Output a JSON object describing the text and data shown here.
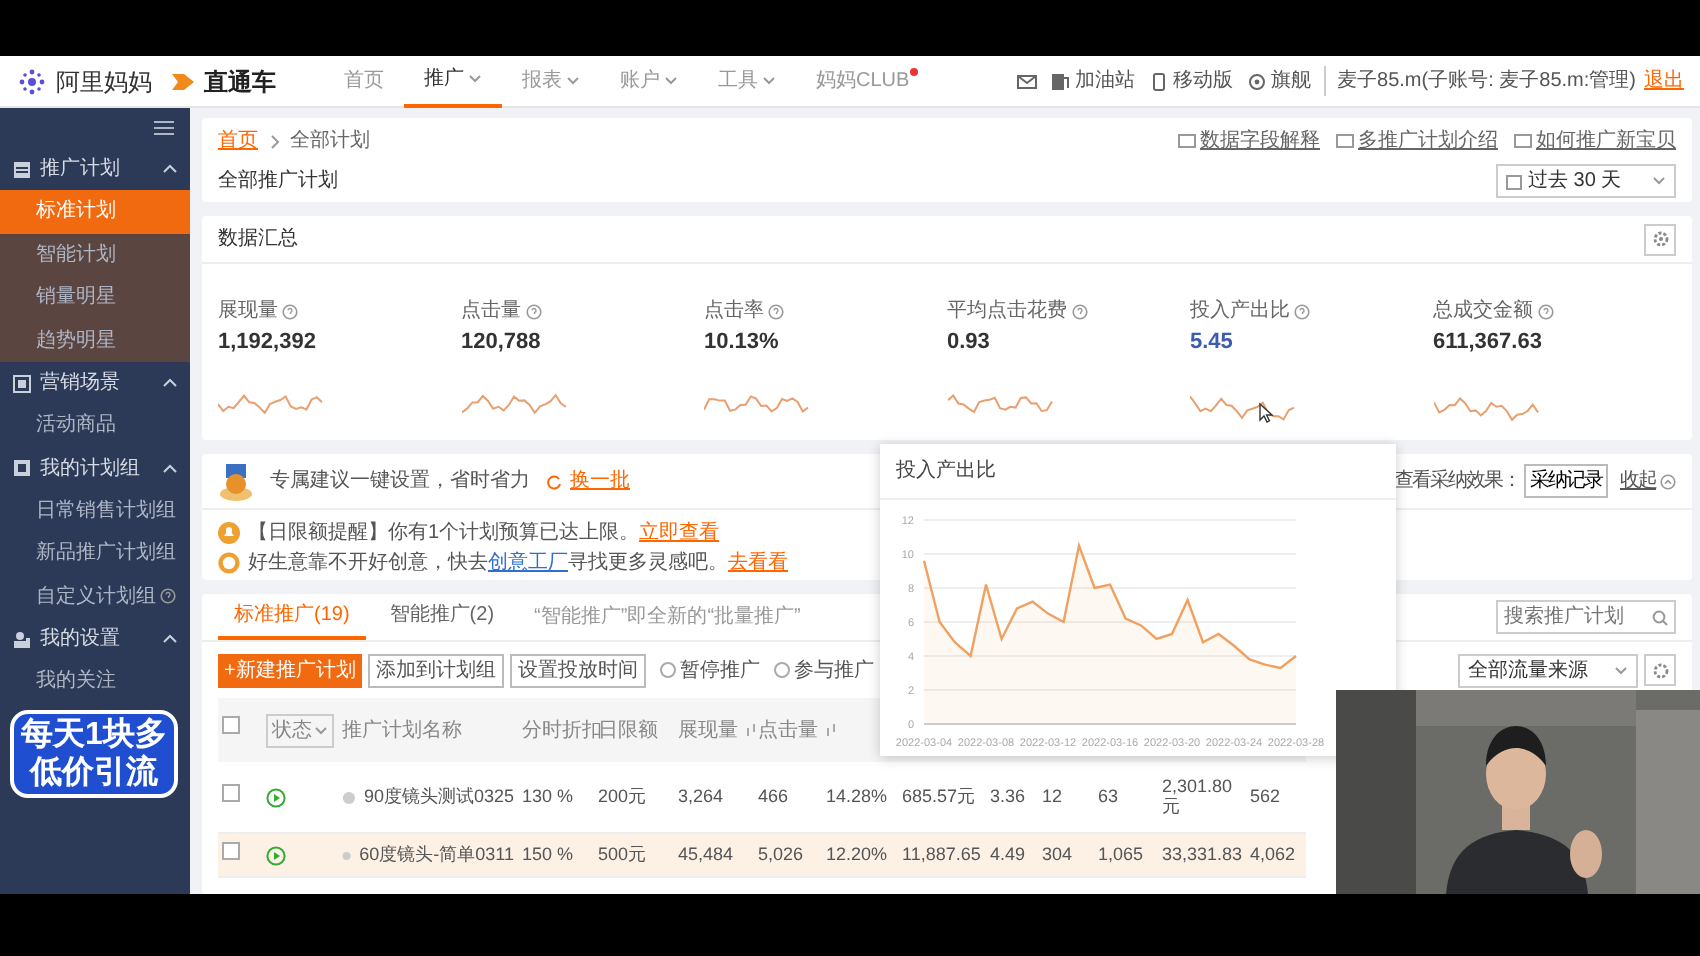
{
  "header": {
    "brand": "阿里妈妈",
    "product": "直通车",
    "nav": [
      {
        "label": "首页",
        "selected": false,
        "caret": false,
        "dot": false
      },
      {
        "label": "推广",
        "selected": true,
        "caret": true,
        "dot": false
      },
      {
        "label": "报表",
        "selected": false,
        "caret": true,
        "dot": false
      },
      {
        "label": "账户",
        "selected": false,
        "caret": true,
        "dot": false
      },
      {
        "label": "工具",
        "selected": false,
        "caret": true,
        "dot": false
      },
      {
        "label": "妈妈CLUB",
        "selected": false,
        "caret": false,
        "dot": true
      }
    ],
    "tools": [
      {
        "kind": "mail"
      },
      {
        "kind": "fuel",
        "label": "加油站"
      },
      {
        "kind": "phone",
        "label": "移动版"
      },
      {
        "kind": "flag",
        "label": "旗舰"
      }
    ],
    "account": "麦子85.m(子账号: 麦子85.m:管理)",
    "logout": "退出"
  },
  "sidebar": {
    "groups": [
      {
        "label": "推广计划",
        "expanded": true,
        "items": [
          {
            "label": "标准计划",
            "selected": true
          },
          {
            "label": "智能计划",
            "selected": false
          },
          {
            "label": "销量明星",
            "selected": false
          },
          {
            "label": "趋势明星",
            "selected": false
          }
        ]
      },
      {
        "label": "营销场景",
        "expanded": true,
        "items": [
          {
            "label": "活动商品",
            "selected": false
          }
        ]
      },
      {
        "label": "我的计划组",
        "expanded": true,
        "items": [
          {
            "label": "日常销售计划组",
            "selected": false
          },
          {
            "label": "新品推广计划组",
            "selected": false
          },
          {
            "label": "自定义计划组",
            "selected": false,
            "help": true
          }
        ]
      },
      {
        "label": "我的设置",
        "expanded": true,
        "items": [
          {
            "label": "我的关注",
            "selected": false
          }
        ]
      }
    ]
  },
  "page": {
    "breadcrumb": [
      "首页",
      "全部计划"
    ],
    "title": "全部推广计划",
    "links": [
      "数据字段解释",
      "多推广计划介绍",
      "如何推广新宝贝"
    ],
    "date_range": "过去 30 天"
  },
  "summary": {
    "title": "数据汇总",
    "stats": [
      {
        "label": "展现量",
        "value": "1,192,392",
        "selected": false
      },
      {
        "label": "点击量",
        "value": "120,788",
        "selected": false
      },
      {
        "label": "点击率",
        "value": "10.13%",
        "selected": false
      },
      {
        "label": "平均点击花费",
        "value": "0.93",
        "selected": false
      },
      {
        "label": "投入产出比",
        "value": "5.45",
        "selected": true
      },
      {
        "label": "总成交金额",
        "value": "611,367.63",
        "selected": false
      }
    ]
  },
  "suggestions": {
    "title": "专属建议一键设置，省时省力",
    "refresh": "换一批",
    "effect_label": "查看采纳效果：",
    "records_button": "采纳记录",
    "collapse": "收起",
    "tips": [
      {
        "parts": [
          {
            "text": "【日限额提醒】你有1个计划预算已达上限。",
            "kind": "text"
          },
          {
            "text": "立即查看",
            "kind": "action"
          }
        ]
      },
      {
        "parts": [
          {
            "text": "好生意靠不开好创意，快去",
            "kind": "text"
          },
          {
            "text": "创意工厂",
            "kind": "link"
          },
          {
            "text": "寻找更多灵感吧。",
            "kind": "text"
          },
          {
            "text": "去看看",
            "kind": "action"
          }
        ]
      }
    ]
  },
  "campaigns": {
    "tabs": [
      {
        "label": "标准推广(19)",
        "selected": true
      },
      {
        "label": "智能推广(2)",
        "selected": false
      }
    ],
    "notice": "“智能推广”即全新的“批量推广”",
    "search_placeholder": "搜索推广计划",
    "actions": [
      {
        "label": "+新建推广计划",
        "kind": "primary"
      },
      {
        "label": "添加到计划组",
        "kind": "outline"
      },
      {
        "label": "设置投放时间",
        "kind": "outline"
      },
      {
        "label": "暂停推广",
        "kind": "radio",
        "checked": false
      },
      {
        "label": "参与推广",
        "kind": "radio",
        "checked": false
      }
    ],
    "source_filter": "全部流量来源",
    "all_checked": false,
    "columns": [
      {
        "label": "状态",
        "kind": "dropdown"
      },
      {
        "label": "推广计划名称",
        "kind": "plain"
      },
      {
        "label": "分时折扣",
        "kind": "plain"
      },
      {
        "label": "日限额",
        "kind": "plain"
      },
      {
        "label": "展现量",
        "kind": "sortable"
      },
      {
        "label": "点击量",
        "kind": "sortable"
      }
    ],
    "rows": [
      {
        "checked": false,
        "highlighted": false,
        "cells": [
          "",
          "90度镜头测试0325",
          "130 %",
          "200元",
          "3,264",
          "466",
          "14.28%",
          "685.57元",
          "3.36",
          "12",
          "63",
          "2,301.80元",
          "562"
        ]
      },
      {
        "checked": false,
        "highlighted": true,
        "cells": [
          "",
          "60度镜头-简单0311",
          "150 %",
          "500元",
          "45,484",
          "5,026",
          "12.20%",
          "11,887.65",
          "4.49",
          "304",
          "1,065",
          "33,331.83",
          "4,062"
        ]
      }
    ]
  },
  "chart_popup": {
    "title": "投入产出比",
    "chart_data": {
      "type": "area",
      "x": [
        "2022-03-04",
        "2022-03-05",
        "2022-03-06",
        "2022-03-07",
        "2022-03-08",
        "2022-03-09",
        "2022-03-10",
        "2022-03-11",
        "2022-03-12",
        "2022-03-13",
        "2022-03-14",
        "2022-03-15",
        "2022-03-16",
        "2022-03-17",
        "2022-03-18",
        "2022-03-19",
        "2022-03-20",
        "2022-03-21",
        "2022-03-22",
        "2022-03-23",
        "2022-03-24",
        "2022-03-25",
        "2022-03-26",
        "2022-03-27",
        "2022-03-28"
      ],
      "series": [
        {
          "color": "#f0a060",
          "values": [
            9.6,
            6,
            4.8,
            4,
            8.2,
            5,
            6.8,
            7.2,
            6.5,
            6,
            10.5,
            8,
            8.2,
            6.2,
            5.8,
            5,
            5.3,
            7.3,
            4.8,
            5.3,
            4.6,
            3.8,
            3.5,
            3.3,
            4
          ]
        }
      ],
      "xlim": [
        "2022-03-04",
        "2022-03-28"
      ],
      "ylim": [
        0,
        12
      ],
      "yticks": [
        0,
        2,
        4,
        6,
        8,
        10,
        12
      ],
      "grid": true,
      "xticks": [
        "2022-03-04",
        "2022-03-08",
        "2022-03-12",
        "2022-03-16",
        "2022-03-20",
        "2022-03-24",
        "2022-03-28"
      ]
    }
  },
  "promo_badge": {
    "lines": [
      "每天1块多",
      "低价引流"
    ]
  }
}
